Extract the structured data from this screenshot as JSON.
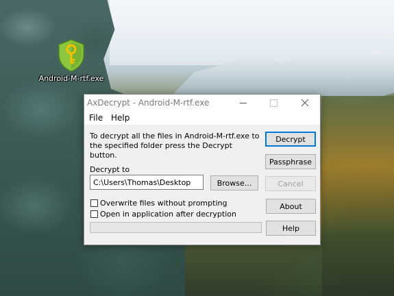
{
  "desktop": {
    "icon": {
      "label": "Android-M-rtf.exe",
      "icon_name": "axcrypt-shield-key-icon",
      "colors": {
        "shield": "#8cc63f",
        "key": "#f3c200"
      }
    }
  },
  "dialog": {
    "title": "AxDecrypt - Android-M-rtf.exe",
    "menu": [
      "File",
      "Help"
    ],
    "instructions": "To decrypt all the files in Android-M-rtf.exe to the specified folder press the Decrypt button.",
    "decrypt_to_label": "Decrypt to",
    "decrypt_to_value": "C:\\Users\\Thomas\\Desktop",
    "buttons": {
      "browse": "Browse...",
      "decrypt": "Decrypt",
      "passphrase": "Passphrase",
      "cancel": "Cancel",
      "about": "About",
      "help": "Help"
    },
    "options": [
      {
        "label": "Overwrite files without prompting",
        "checked": false
      },
      {
        "label": "Open in application after decryption",
        "checked": false
      }
    ],
    "progress": 0,
    "accent_color": "#0078d7"
  }
}
